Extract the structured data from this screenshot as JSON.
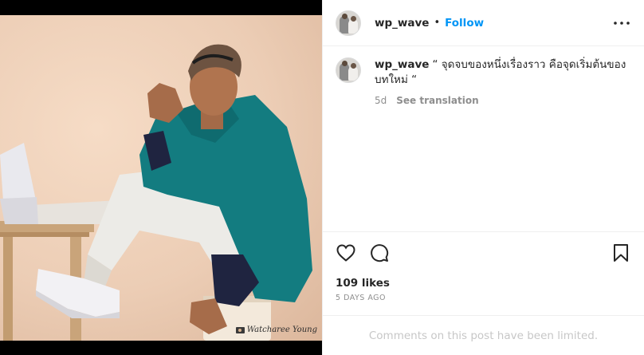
{
  "post": {
    "username": "wp_wave",
    "follow_label": "Follow",
    "separator": "•",
    "caption": {
      "username": "wp_wave",
      "text": "“ จุดจบของหนึ่งเรื่องราว คือจุดเริ่มต้นของบทใหม่ “",
      "age": "5d",
      "see_translation": "See translation"
    },
    "likes": "109 likes",
    "posted_ago": "5 DAYS AGO",
    "comments_notice": "Comments on this post have been limited.",
    "photo": {
      "watermark": "Watcharee Young"
    }
  },
  "icons": {
    "more": "more-options-icon",
    "like": "heart-icon",
    "comment": "comment-icon",
    "save": "bookmark-icon",
    "camera": "camera-icon"
  },
  "colors": {
    "accent": "#0095f6",
    "text": "#262626",
    "muted": "#8e8e8e",
    "disabled": "#c7c7c7",
    "border": "#efefef",
    "photo_background": "#eccdb5",
    "sweater": "#137c80"
  }
}
